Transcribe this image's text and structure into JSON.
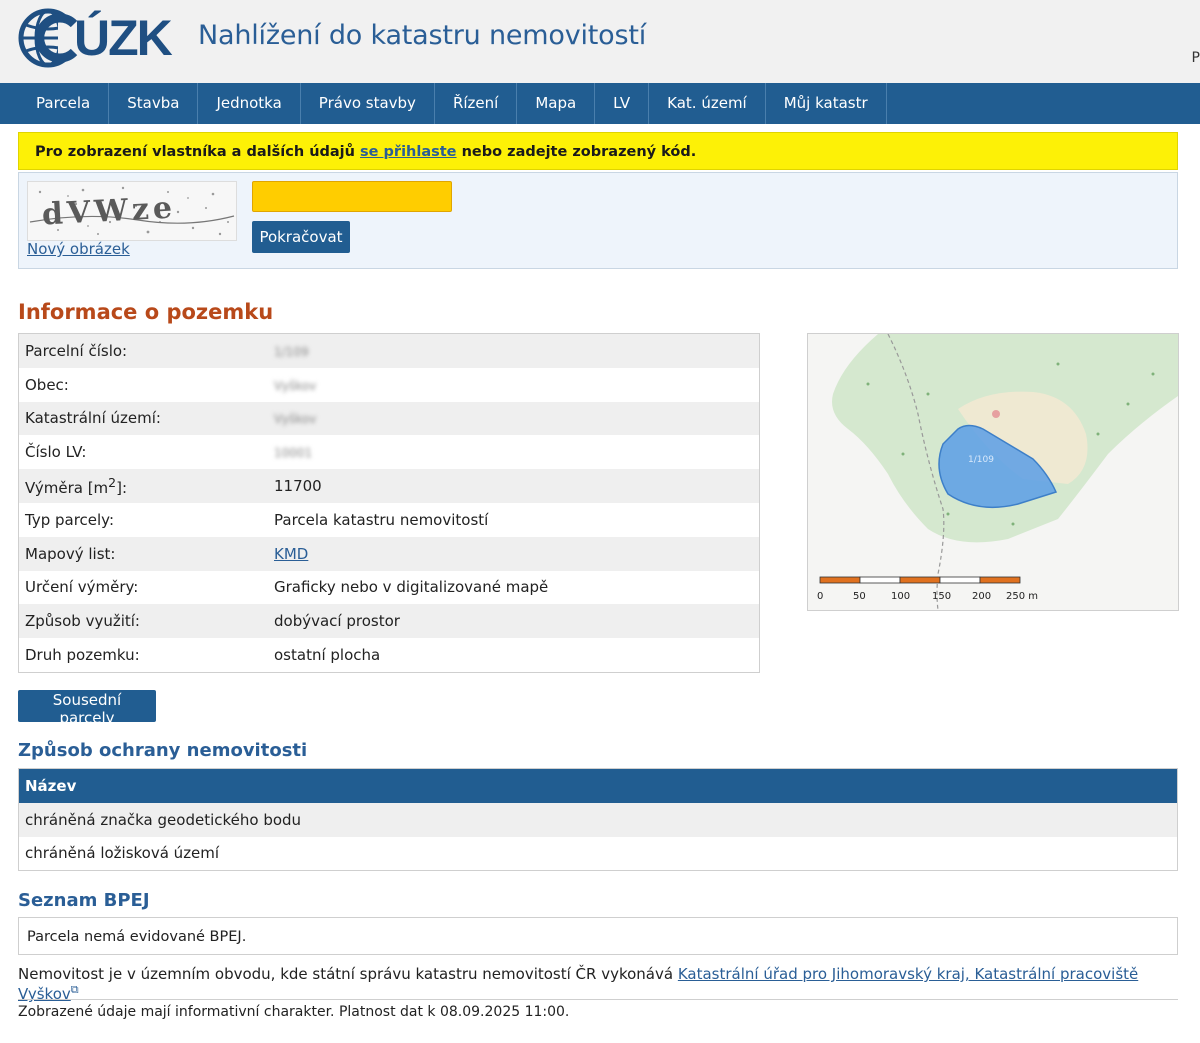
{
  "header": {
    "logo_text": "ÚZK",
    "app_title": "Nahlížení do katastru nemovitostí",
    "edge_letter": "P"
  },
  "nav": {
    "items": [
      {
        "label": "Parcela"
      },
      {
        "label": "Stavba"
      },
      {
        "label": "Jednotka"
      },
      {
        "label": "Právo stavby"
      },
      {
        "label": "Řízení"
      },
      {
        "label": "Mapa"
      },
      {
        "label": "LV"
      },
      {
        "label": "Kat. území"
      },
      {
        "label": "Můj katastr"
      }
    ]
  },
  "notice": {
    "before": "Pro zobrazení vlastníka a dalších údajů ",
    "link": "se přihlaste",
    "after": " nebo zadejte zobrazený kód."
  },
  "captcha": {
    "image_text": "dVWze",
    "new_image_label": "Nový obrázek",
    "input_value": "",
    "continue_label": "Pokračovat"
  },
  "land_info": {
    "title": "Informace o pozemku",
    "rows": [
      {
        "label": "Parcelní číslo:",
        "value": "1/109"
      },
      {
        "label": "Obec:",
        "value": "Vyškov"
      },
      {
        "label": "Katastrální území:",
        "value": "Vyškov"
      },
      {
        "label": "Číslo LV:",
        "value": "10001"
      },
      {
        "label_main": "Výměra [m",
        "label_sup": "2",
        "label_end": "]:",
        "value": "11700"
      },
      {
        "label": "Typ parcely:",
        "value": "Parcela katastru nemovitostí"
      },
      {
        "label": "Mapový list:",
        "value": "KMD"
      },
      {
        "label": "Určení výměry:",
        "value": "Graficky nebo v digitalizované mapě"
      },
      {
        "label": "Způsob využití:",
        "value": "dobývací prostor"
      },
      {
        "label": "Druh pozemku:",
        "value": "ostatní plocha"
      }
    ]
  },
  "map": {
    "parcel_label": "1/109",
    "scale_labels": [
      "0",
      "50",
      "100",
      "150",
      "200",
      "250 m"
    ],
    "colors": {
      "forest": "#d5e8cf",
      "parcel": "#5b9ee6",
      "clearing": "#efe9d2",
      "scale_orange": "#e0711f"
    }
  },
  "neighbors_label": "Sousední parcely",
  "protection": {
    "title": "Způsob ochrany nemovitosti",
    "header": "Název",
    "rows": [
      "chráněná značka geodetického bodu",
      "chráněná ložisková území"
    ]
  },
  "bpej": {
    "title": "Seznam BPEJ",
    "text": "Parcela nemá evidované BPEJ."
  },
  "office": {
    "text": "Nemovitost je v územním obvodu, kde státní správu katastru nemovitostí ČR vykonává ",
    "link": "Katastrální úřad pro Jihomoravský kraj, Katastrální pracoviště Vyškov"
  },
  "footer": {
    "note": "Zobrazené údaje mají informativní charakter. Platnost dat k 08.09.2025 11:00."
  },
  "colors": {
    "primary": "#215d91",
    "notice": "#fdf106",
    "heading_orange": "#b8491a",
    "input_yellow": "#ffcd00"
  }
}
